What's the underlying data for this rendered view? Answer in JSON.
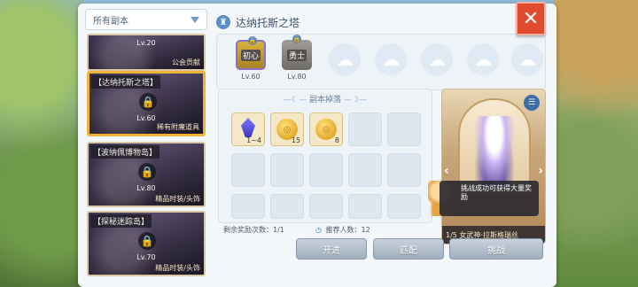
{
  "filter": {
    "label": "所有副本"
  },
  "dungeons": [
    {
      "title": "",
      "level": "Lv.20",
      "reward": "公会贡献"
    },
    {
      "title": "【达纳托斯之塔】",
      "level": "Lv.60",
      "reward": "稀有附魔道具"
    },
    {
      "title": "【波纳佩博物岛】",
      "level": "Lv.80",
      "reward": "精品时装/头饰"
    },
    {
      "title": "【探秘迷踪岛】",
      "level": "Lv.70",
      "reward": "精品时装/头饰"
    }
  ],
  "header": {
    "title": "达纳托斯之塔",
    "icon": "tower-icon"
  },
  "difficulty": [
    {
      "label": "初心",
      "level": "Lv.60"
    },
    {
      "label": "勇士",
      "level": "Lv.80"
    }
  ],
  "drops": {
    "title": "副本掉落",
    "items": [
      {
        "icon": "gem-icon",
        "qty": "1~4"
      },
      {
        "icon": "coin-icon",
        "qty": "15"
      },
      {
        "icon": "coin-icon",
        "qty": "8"
      }
    ]
  },
  "info": {
    "remaining_label": "剩余奖励次数：1/1",
    "recommend_label": "推荐人数：12"
  },
  "preview": {
    "tip": "挑战成功可获得大量奖励",
    "footer": "1/5 女武神·拉斯格瑞丝"
  },
  "buttons": {
    "left": "开进",
    "middle": "匹配",
    "right": "挑战"
  },
  "colors": {
    "accent": "#f0b33a",
    "close": "#e04a2f"
  }
}
